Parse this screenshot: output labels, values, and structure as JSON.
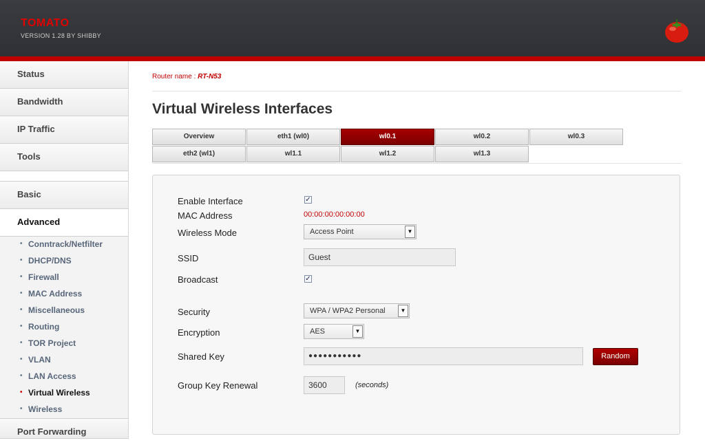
{
  "brand": {
    "name": "TOMATO",
    "version": "VERSION 1.28 BY SHIBBY"
  },
  "nav": {
    "main_top": [
      "Status",
      "Bandwidth",
      "IP Traffic",
      "Tools"
    ],
    "main_mid": [
      "Basic",
      "Advanced"
    ],
    "sub": [
      "Conntrack/Netfilter",
      "DHCP/DNS",
      "Firewall",
      "MAC Address",
      "Miscellaneous",
      "Routing",
      "TOR Project",
      "VLAN",
      "LAN Access",
      "Virtual Wireless",
      "Wireless"
    ],
    "main_bottom": "Port Forwarding",
    "active_sub": "Virtual Wireless"
  },
  "router": {
    "label": "Router name :",
    "name": "RT-N53"
  },
  "page_title": "Virtual Wireless Interfaces",
  "tabs": {
    "row1": [
      "Overview",
      "eth1 (wl0)",
      "wl0.1",
      "wl0.2",
      "wl0.3"
    ],
    "row2": [
      "eth2 (wl1)",
      "wl1.1",
      "wl1.2",
      "wl1.3"
    ],
    "active": "wl0.1"
  },
  "form": {
    "enable_label": "Enable Interface",
    "mac_label": "MAC Address",
    "mac_value": "00:00:00:00:00:00",
    "mode_label": "Wireless Mode",
    "mode_value": "Access Point",
    "ssid_label": "SSID",
    "ssid_value": "Guest",
    "broadcast_label": "Broadcast",
    "security_label": "Security",
    "security_value": "WPA / WPA2 Personal",
    "encryption_label": "Encryption",
    "encryption_value": "AES",
    "key_label": "Shared Key",
    "key_value": "●●●●●●●●●●●",
    "random_button": "Random",
    "renewal_label": "Group Key Renewal",
    "renewal_value": "3600",
    "renewal_unit": "(seconds)"
  },
  "icons": {
    "checkmark": "✓",
    "dropdown": "▼",
    "bullet": "•"
  }
}
